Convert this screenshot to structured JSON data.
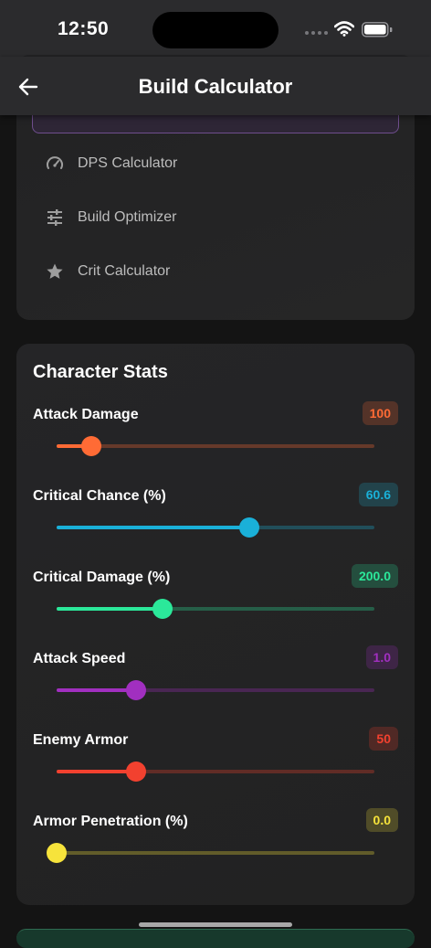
{
  "status": {
    "time": "12:50"
  },
  "header": {
    "title": "Build Calculator"
  },
  "menu": {
    "items": [
      {
        "label": "DPS Calculator",
        "icon": "speedometer-icon"
      },
      {
        "label": "Build Optimizer",
        "icon": "tune-sliders-icon"
      },
      {
        "label": "Crit Calculator",
        "icon": "star-icon"
      }
    ]
  },
  "stats": {
    "title": "Character Stats",
    "items": [
      {
        "label": "Attack Damage",
        "value": "100",
        "fraction": 0.11,
        "color": "#ff6b35"
      },
      {
        "label": "Critical Chance (%)",
        "value": "60.6",
        "fraction": 0.606,
        "color": "#1ab0d8"
      },
      {
        "label": "Critical Damage (%)",
        "value": "200.0",
        "fraction": 0.333,
        "color": "#2be89a"
      },
      {
        "label": "Attack Speed",
        "value": "1.0",
        "fraction": 0.25,
        "color": "#a12fc0"
      },
      {
        "label": "Enemy Armor",
        "value": "50",
        "fraction": 0.25,
        "color": "#f2412f"
      },
      {
        "label": "Armor Penetration (%)",
        "value": "0.0",
        "fraction": 0.0,
        "color": "#f6e33b"
      }
    ]
  }
}
